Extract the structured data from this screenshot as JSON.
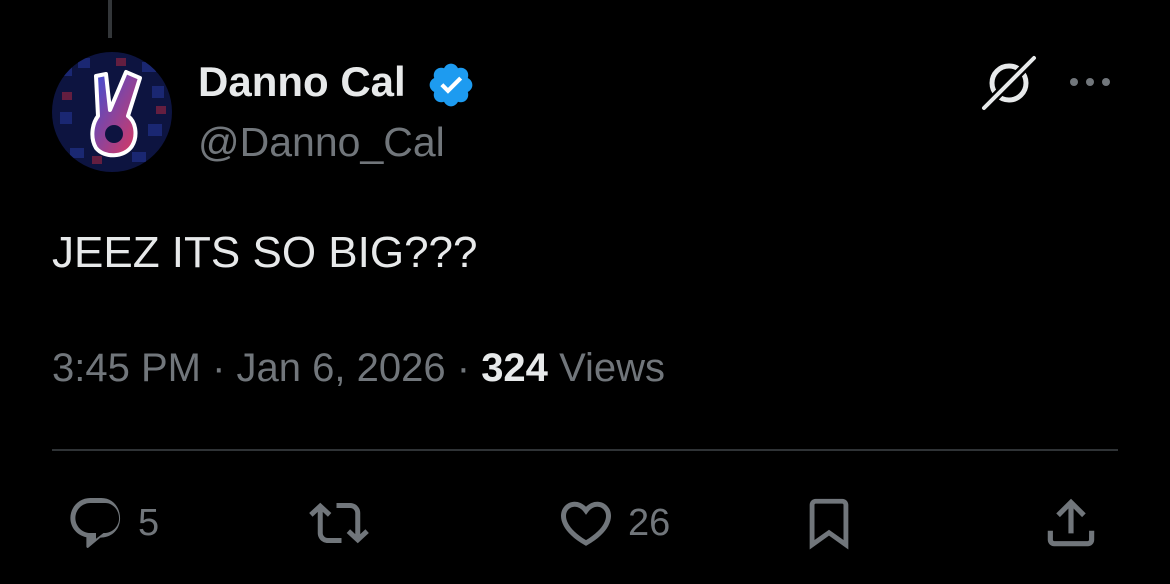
{
  "author": {
    "display_name": "Danno Cal",
    "handle": "@Danno_Cal",
    "verified": true,
    "verified_color": "#1d9bf0"
  },
  "tweet": {
    "text": "JEEZ ITS SO BIG???",
    "time": "3:45 PM",
    "date": "Jan 6, 2026",
    "views_count": "324",
    "views_label": "Views",
    "separator": "·"
  },
  "actions": {
    "reply_count": "5",
    "like_count": "26"
  },
  "icons": {
    "header": [
      "grok-icon",
      "more-icon"
    ],
    "footer": [
      "reply-icon",
      "retweet-icon",
      "like-icon",
      "bookmark-icon",
      "share-icon"
    ]
  },
  "colors": {
    "background": "#000000",
    "primary_text": "#e7e9ea",
    "secondary_text": "#71767b",
    "divider": "#2f3336"
  }
}
